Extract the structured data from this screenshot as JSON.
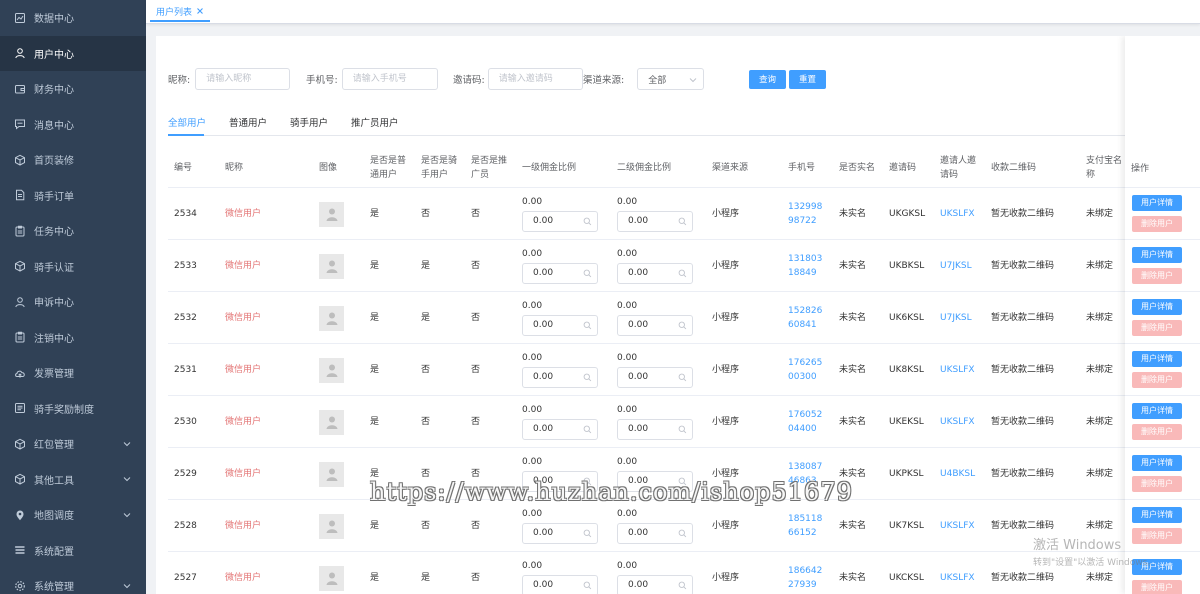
{
  "sidebar": {
    "items": [
      {
        "label": "数据中心",
        "icon": "chart-icon",
        "active": false,
        "arrow": false
      },
      {
        "label": "用户中心",
        "icon": "user-icon",
        "active": true,
        "arrow": false
      },
      {
        "label": "财务中心",
        "icon": "wallet-icon",
        "active": false,
        "arrow": false
      },
      {
        "label": "消息中心",
        "icon": "message-icon",
        "active": false,
        "arrow": false
      },
      {
        "label": "首页装修",
        "icon": "cube-icon",
        "active": false,
        "arrow": false
      },
      {
        "label": "骑手订单",
        "icon": "document-icon",
        "active": false,
        "arrow": false
      },
      {
        "label": "任务中心",
        "icon": "clipboard-icon",
        "active": false,
        "arrow": false
      },
      {
        "label": "骑手认证",
        "icon": "cube-icon",
        "active": false,
        "arrow": false
      },
      {
        "label": "申诉中心",
        "icon": "user-icon",
        "active": false,
        "arrow": false
      },
      {
        "label": "注销中心",
        "icon": "clipboard-icon",
        "active": false,
        "arrow": false
      },
      {
        "label": "发票管理",
        "icon": "cloud-icon",
        "active": false,
        "arrow": false
      },
      {
        "label": "骑手奖励制度",
        "icon": "list-icon",
        "active": false,
        "arrow": false
      },
      {
        "label": "红包管理",
        "icon": "cube-icon",
        "active": false,
        "arrow": true
      },
      {
        "label": "其他工具",
        "icon": "cube-icon",
        "active": false,
        "arrow": true
      },
      {
        "label": "地图调度",
        "icon": "location-icon",
        "active": false,
        "arrow": true
      },
      {
        "label": "系统配置",
        "icon": "menu-icon",
        "active": false,
        "arrow": false
      },
      {
        "label": "系统管理",
        "icon": "gear-icon",
        "active": false,
        "arrow": true
      }
    ]
  },
  "tabbar": {
    "tab_label": "用户列表"
  },
  "filters": {
    "nickname_label": "昵称:",
    "nickname_placeholder": "请输入昵称",
    "phone_label": "手机号:",
    "phone_placeholder": "请输入手机号",
    "invite_label": "邀请码:",
    "invite_placeholder": "请输入邀请码",
    "channel_label": "渠道来源:",
    "channel_value": "全部",
    "search_label": "查询",
    "reset_label": "重置"
  },
  "user_tabs": [
    "全部用户",
    "普通用户",
    "骑手用户",
    "推广员用户"
  ],
  "table": {
    "headers": {
      "id": "编号",
      "nickname": "昵称",
      "avatar": "图像",
      "is_normal": "是否是普通用户",
      "is_rider": "是否是骑手用户",
      "is_promoter": "是否是推广员",
      "ratio1": "一级佣金比例",
      "ratio2": "二级佣金比例",
      "channel": "渠道来源",
      "phone": "手机号",
      "realname": "是否实名",
      "invite_code": "邀请码",
      "inviter_code": "邀请人邀请码",
      "qrcode": "收款二维码",
      "alipay": "支付宝名称",
      "ops": "操作"
    },
    "rows": [
      {
        "id": "2534",
        "nickname": "微信用户",
        "is_normal": "是",
        "is_rider": "否",
        "is_promoter": "否",
        "ratio1": "0.00",
        "ratio1_input": "0.00",
        "ratio2": "0.00",
        "ratio2_input": "0.00",
        "channel": "小程序",
        "phone": "13299898722",
        "realname": "未实名",
        "invite_code": "UKGKSL",
        "inviter_code": "UKSLFX",
        "qrcode": "暂无收款二维码",
        "alipay": "未绑定"
      },
      {
        "id": "2533",
        "nickname": "微信用户",
        "is_normal": "是",
        "is_rider": "是",
        "is_promoter": "否",
        "ratio1": "0.00",
        "ratio1_input": "0.00",
        "ratio2": "0.00",
        "ratio2_input": "0.00",
        "channel": "小程序",
        "phone": "13180318849",
        "realname": "未实名",
        "invite_code": "UKBKSL",
        "inviter_code": "U7JKSL",
        "qrcode": "暂无收款二维码",
        "alipay": "未绑定"
      },
      {
        "id": "2532",
        "nickname": "微信用户",
        "is_normal": "是",
        "is_rider": "是",
        "is_promoter": "否",
        "ratio1": "0.00",
        "ratio1_input": "0.00",
        "ratio2": "0.00",
        "ratio2_input": "0.00",
        "channel": "小程序",
        "phone": "15282660841",
        "realname": "未实名",
        "invite_code": "UK6KSL",
        "inviter_code": "U7JKSL",
        "qrcode": "暂无收款二维码",
        "alipay": "未绑定"
      },
      {
        "id": "2531",
        "nickname": "微信用户",
        "is_normal": "是",
        "is_rider": "否",
        "is_promoter": "否",
        "ratio1": "0.00",
        "ratio1_input": "0.00",
        "ratio2": "0.00",
        "ratio2_input": "0.00",
        "channel": "小程序",
        "phone": "17626500300",
        "realname": "未实名",
        "invite_code": "UK8KSL",
        "inviter_code": "UKSLFX",
        "qrcode": "暂无收款二维码",
        "alipay": "未绑定"
      },
      {
        "id": "2530",
        "nickname": "微信用户",
        "is_normal": "是",
        "is_rider": "否",
        "is_promoter": "否",
        "ratio1": "0.00",
        "ratio1_input": "0.00",
        "ratio2": "0.00",
        "ratio2_input": "0.00",
        "channel": "小程序",
        "phone": "17605204400",
        "realname": "未实名",
        "invite_code": "UKEKSL",
        "inviter_code": "UKSLFX",
        "qrcode": "暂无收款二维码",
        "alipay": "未绑定"
      },
      {
        "id": "2529",
        "nickname": "微信用户",
        "is_normal": "是",
        "is_rider": "否",
        "is_promoter": "否",
        "ratio1": "0.00",
        "ratio1_input": "0.00",
        "ratio2": "0.00",
        "ratio2_input": "0.00",
        "channel": "小程序",
        "phone": "13808746863",
        "realname": "未实名",
        "invite_code": "UKPKSL",
        "inviter_code": "U4BKSL",
        "qrcode": "暂无收款二维码",
        "alipay": "未绑定"
      },
      {
        "id": "2528",
        "nickname": "微信用户",
        "is_normal": "是",
        "is_rider": "否",
        "is_promoter": "否",
        "ratio1": "0.00",
        "ratio1_input": "0.00",
        "ratio2": "0.00",
        "ratio2_input": "0.00",
        "channel": "小程序",
        "phone": "18511866152",
        "realname": "未实名",
        "invite_code": "UK7KSL",
        "inviter_code": "UKSLFX",
        "qrcode": "暂无收款二维码",
        "alipay": "未绑定"
      },
      {
        "id": "2527",
        "nickname": "微信用户",
        "is_normal": "是",
        "is_rider": "是",
        "is_promoter": "否",
        "ratio1": "0.00",
        "ratio1_input": "0.00",
        "ratio2": "0.00",
        "ratio2_input": "0.00",
        "channel": "小程序",
        "phone": "18664227939",
        "realname": "未实名",
        "invite_code": "UKCKSL",
        "inviter_code": "UKSLFX",
        "qrcode": "暂无收款二维码",
        "alipay": "未绑定"
      }
    ],
    "detail_label": "用户详情",
    "delete_label": "删除用户"
  },
  "overlay": {
    "watermark": "https://www.huzhan.com/ishop51679",
    "activate_title": "激活 Windows",
    "activate_sub": "转到\"设置\"以激活 Windows。"
  },
  "colors": {
    "sidebar_bg": "#304156",
    "sidebar_active": "#263445",
    "primary": "#409eff",
    "danger_light": "#f9b9b9",
    "nickname": "#e37474"
  }
}
